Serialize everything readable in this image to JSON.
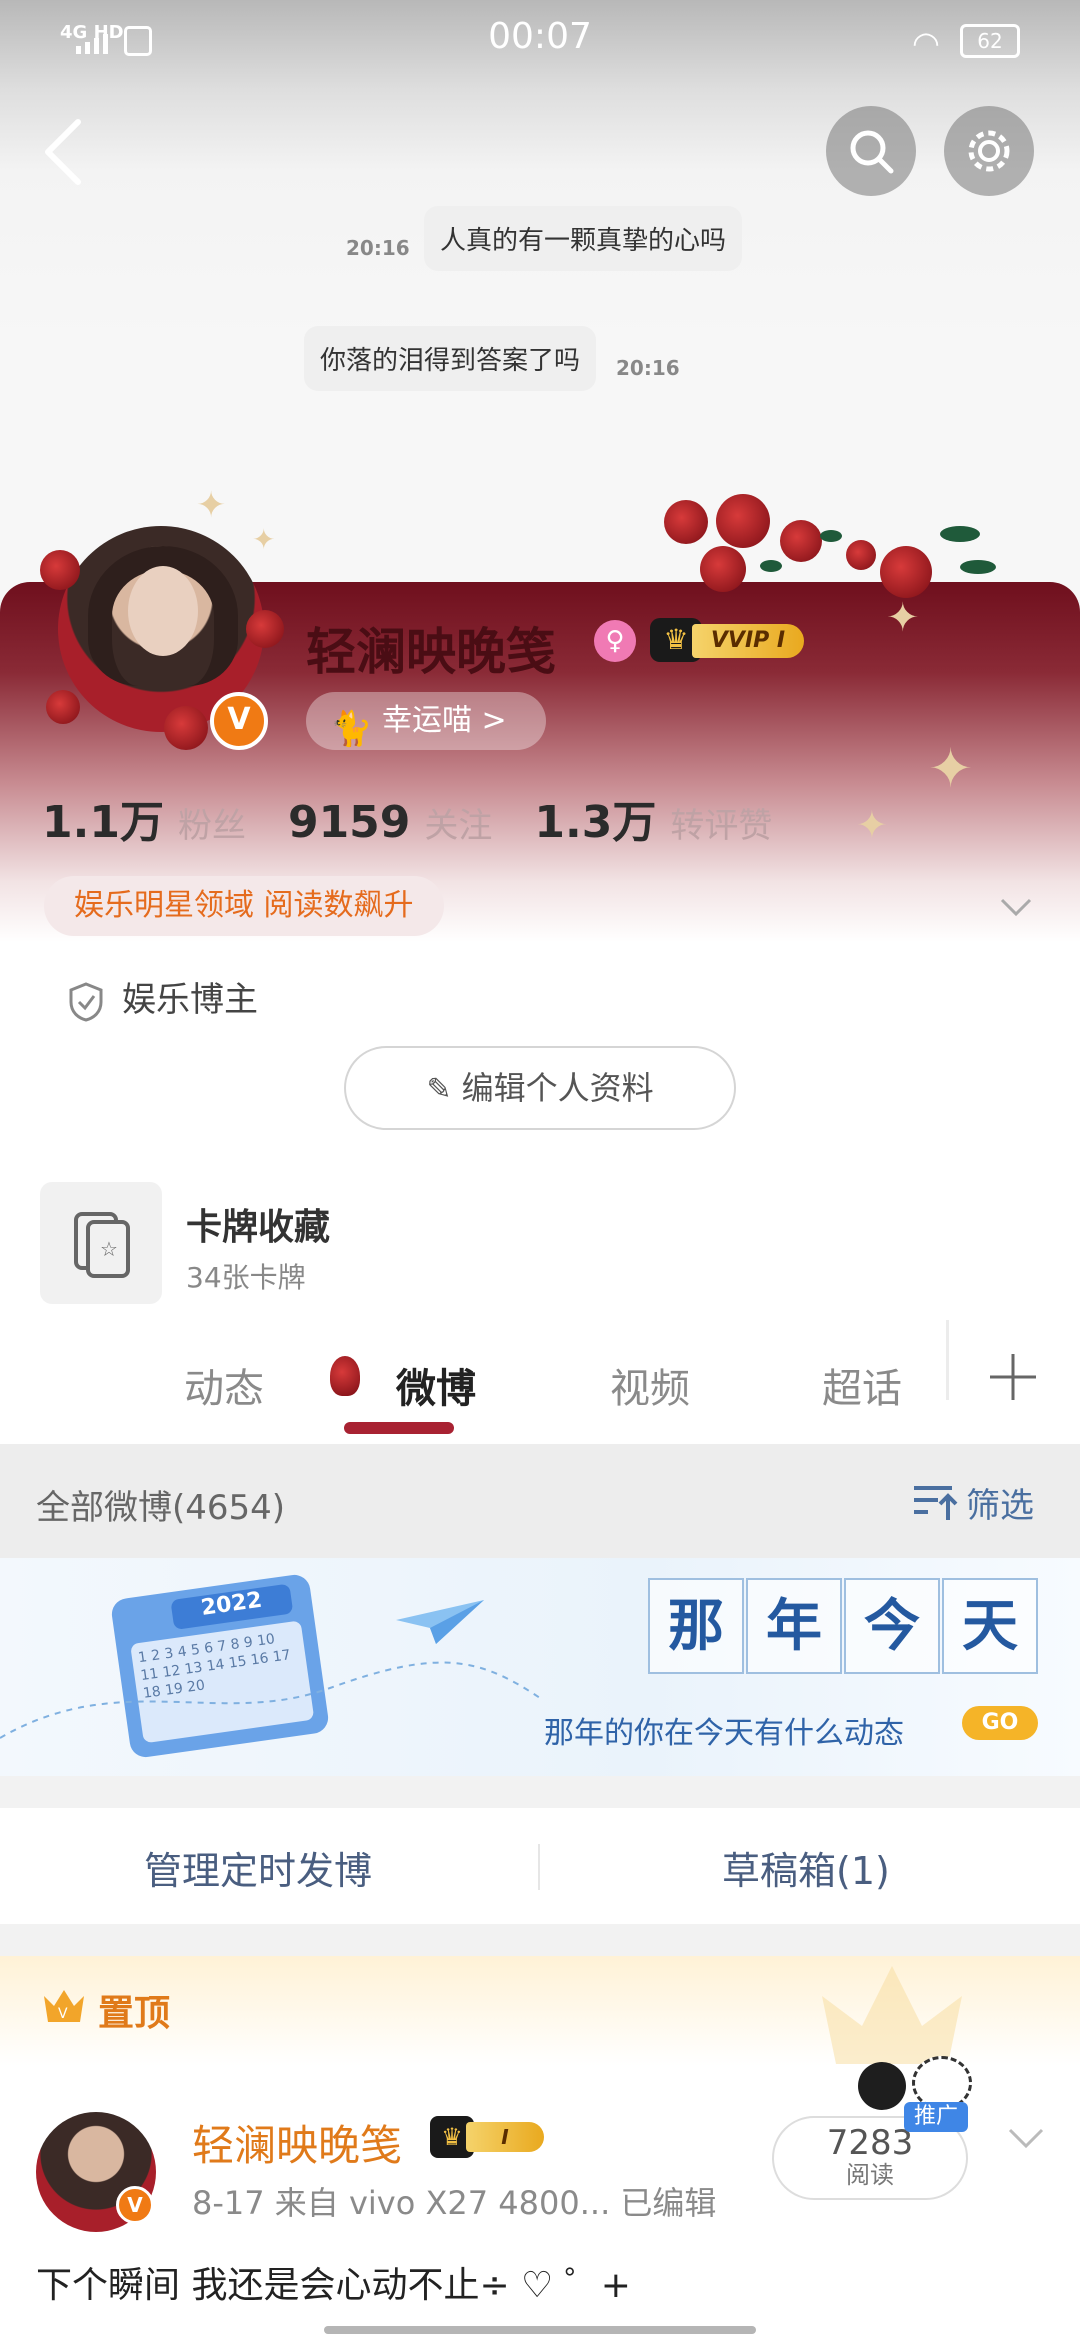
{
  "status_bar": {
    "network": "4G HD",
    "time": "00:07",
    "battery": "62"
  },
  "chat": [
    {
      "time": "20:16",
      "text": "人真的有一颗真挚的心吗"
    },
    {
      "time": "20:16",
      "text": "你落的泪得到答案了吗"
    }
  ],
  "profile": {
    "name": "轻澜映晚笺",
    "vip_label": "VVIP I",
    "lucky_label": "幸运喵 >",
    "stats": [
      {
        "num": "1.1万",
        "label": "粉丝"
      },
      {
        "num": "9159",
        "label": "关注"
      },
      {
        "num": "1.3万",
        "label": "转评赞"
      }
    ],
    "tag": "娱乐明星领域 阅读数飙升",
    "blogger": "娱乐博主",
    "edit_button": "编辑个人资料"
  },
  "card_collection": {
    "title": "卡牌收藏",
    "subtitle": "34张卡牌"
  },
  "tabs": [
    "动态",
    "微博",
    "视频",
    "超话"
  ],
  "active_tab": "微博",
  "filter": {
    "total": "全部微博(4654)",
    "filter_label": "筛选"
  },
  "banner": {
    "calendar_year": "2022",
    "calendar_days": "1 2 3 4 5 6 7 8 9 10 11 12 13 14 15 16 17 18 19 20",
    "title_chars": [
      "那",
      "年",
      "今",
      "天"
    ],
    "subtitle": "那年的你在今天有什么动态",
    "go": "GO"
  },
  "manage": {
    "left": "管理定时发博",
    "right": "草稿箱(1)"
  },
  "feed": {
    "pinned_label": "置顶",
    "post": {
      "name": "轻澜映晚笺",
      "vip_label": "I",
      "meta": "8-17  来自 vivo X27 4800...  已编辑",
      "reads": "7283",
      "reads_label": "阅读",
      "promo": "推广",
      "text": "下个瞬间 我还是会心动不止÷ ♡ ゜+"
    }
  },
  "colors": {
    "accent": "#e07a1a",
    "link_blue": "#4a6fa0",
    "wine": "#6f0f1d"
  }
}
